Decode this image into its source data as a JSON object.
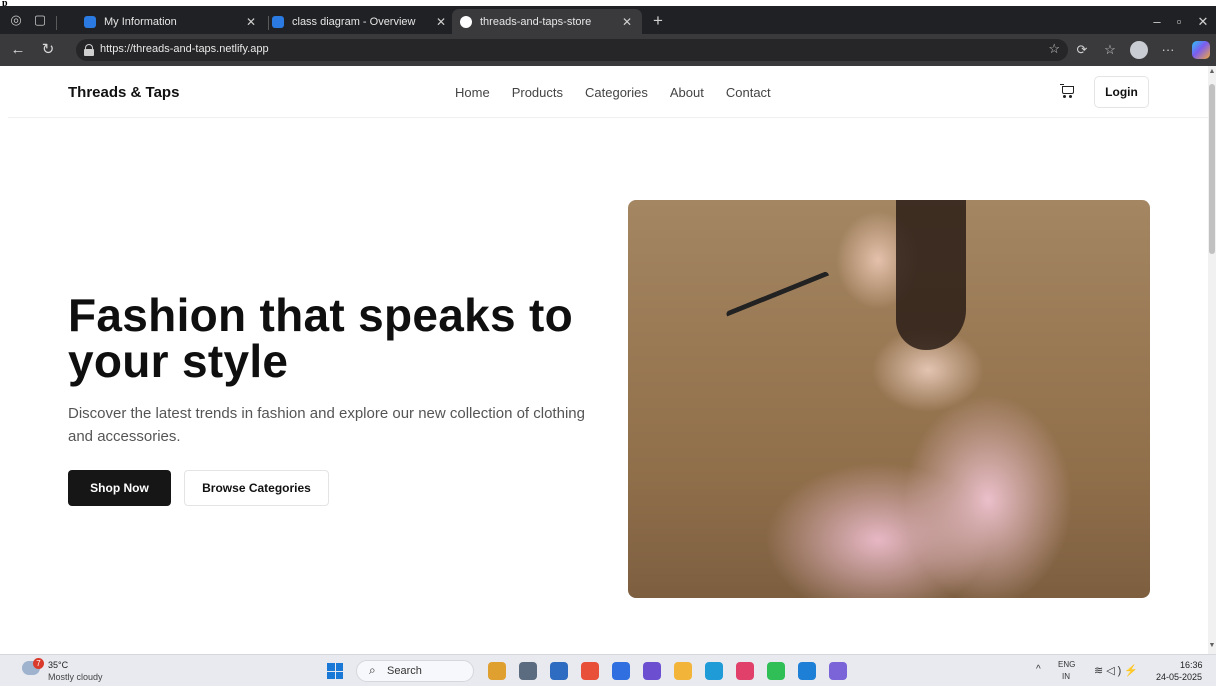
{
  "browser": {
    "tabs": [
      {
        "title": "My Information",
        "favicon_color": "#2a7ae2"
      },
      {
        "title": "class diagram - Overview",
        "favicon_color": "#2a7ae2"
      },
      {
        "title": "threads-and-taps-store",
        "favicon_color": "#ffffff"
      }
    ],
    "active_tab_index": 2,
    "url": "https://threads-and-taps.netlify.app",
    "icons": {
      "tab_actions": "tab-actions-icon",
      "vertical_tabs": "vertical-tabs-icon",
      "close": "close-icon",
      "new_tab": "plus-icon",
      "minimize": "minimize-icon",
      "maximize": "maximize-icon",
      "back": "back-arrow-icon",
      "refresh": "refresh-icon",
      "favorite": "star-icon",
      "extensions": "extensions-icon",
      "favorites": "favorites-icon",
      "more": "more-icon"
    }
  },
  "site": {
    "brand": "Threads & Taps",
    "nav": [
      "Home",
      "Products",
      "Categories",
      "About",
      "Contact"
    ],
    "login_label": "Login",
    "hero": {
      "title": "Fashion that speaks to your style",
      "subtitle": "Discover the latest trends in fashion and explore our new collection of clothing and accessories.",
      "primary_cta": "Shop Now",
      "secondary_cta": "Browse Categories"
    }
  },
  "taskbar": {
    "weather_badge": "7",
    "temperature": "35°C",
    "weather": "Mostly cloudy",
    "search_label": "Search",
    "language_line1": "ENG",
    "language_line2": "IN",
    "time": "16:36",
    "date": "24-05-2025",
    "app_colors": [
      "#e0a030",
      "#5b6b80",
      "#2d6cc0",
      "#e8503a",
      "#2f6fe0",
      "#6b4fd0",
      "#f2b53a",
      "#1f9bd8",
      "#e0406a",
      "#2fbf56",
      "#1e7fd6",
      "#7a64d8"
    ]
  },
  "colors": {
    "primary_button": "#161616",
    "chrome_dark": "#202124",
    "accent_blue": "#1a78d6"
  }
}
